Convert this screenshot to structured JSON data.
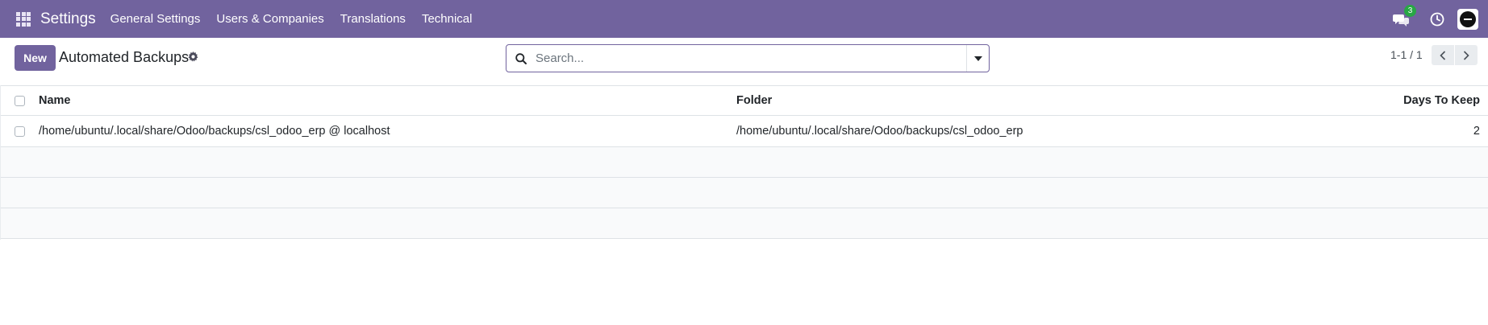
{
  "navbar": {
    "app_name": "Settings",
    "menus": [
      "General Settings",
      "Users & Companies",
      "Translations",
      "Technical"
    ],
    "chat_count": "3",
    "brand_color": "#71639e"
  },
  "control_panel": {
    "new_label": "New",
    "title": "Automated Backups",
    "search_placeholder": "Search...",
    "pager_value": "1-1 / 1"
  },
  "table": {
    "columns": [
      "Name",
      "Folder",
      "Days To Keep"
    ],
    "rows": [
      {
        "name": "/home/ubuntu/.local/share/Odoo/backups/csl_odoo_erp @ localhost",
        "folder": "/home/ubuntu/.local/share/Odoo/backups/csl_odoo_erp",
        "days_to_keep": "2"
      }
    ]
  },
  "icons": {
    "apps": "apps-grid-icon",
    "chat": "chat-icon",
    "activity": "clock-icon",
    "settings": "gear-icon",
    "search": "search-icon",
    "dropdown": "caret-down-icon",
    "prev": "chevron-left-icon",
    "next": "chevron-right-icon"
  }
}
